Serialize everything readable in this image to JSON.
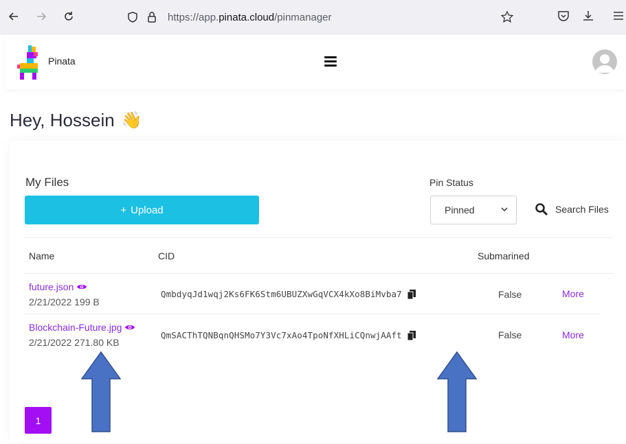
{
  "browser": {
    "url_prefix": "https://app.",
    "url_domain": "pinata.cloud",
    "url_path": "/pinmanager"
  },
  "header": {
    "brand": "Pinata"
  },
  "greeting": {
    "text": "Hey, Hossein",
    "emoji": "👋"
  },
  "files": {
    "title": "My Files",
    "upload_label": "Upload",
    "upload_icon": "+"
  },
  "filters": {
    "pin_status_label": "Pin Status",
    "pin_status_value": "Pinned",
    "search_label": "Search Files"
  },
  "table": {
    "columns": [
      "Name",
      "CID",
      "Submarined"
    ],
    "rows": [
      {
        "name": "future.json",
        "meta": "2/21/2022 199 B",
        "cid": "QmbdyqJd1wqj2Ks6FK6Stm6UBUZXwGqVCX4kXo8BiMvba7",
        "submarined": "False",
        "more": "More"
      },
      {
        "name": "Blockchain-Future.jpg",
        "meta": "2/21/2022 271.80 KB",
        "cid": "QmSACThTQNBqnQHSMo7Y3Vc7xAo4TpoNfXHLiCQnwjAAft",
        "submarined": "False",
        "more": "More"
      }
    ]
  },
  "pagination": {
    "current": "1"
  },
  "colors": {
    "accent_purple": "#a20ff5",
    "upload_cyan": "#1cc0e3",
    "link_purple": "#8a2be2",
    "annotation_arrow": "#4a72c4"
  }
}
